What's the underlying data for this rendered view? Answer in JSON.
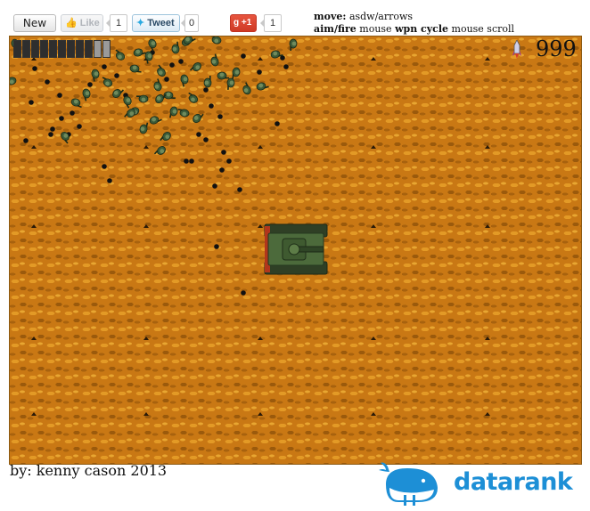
{
  "toolbar": {
    "new_label": "New",
    "like_label": "Like",
    "like_count": "1",
    "tweet_label": "Tweet",
    "tweet_count": "0",
    "plus_label": "+1",
    "plus_count": "1"
  },
  "controls": {
    "move_key": "move:",
    "move_val": "asdw/arrows",
    "aim_key": "aim/fire",
    "aim_val": "mouse",
    "wpn_key": "wpn cycle",
    "wpn_val": "mouse scroll"
  },
  "hud": {
    "health_segments_filled": 9,
    "health_segments_total": 11,
    "ammo": "999",
    "ammo_icon": "rocket-icon"
  },
  "footer": {
    "credit": "by: kenny cason 2013",
    "brand_name": "datarank",
    "brand_icon": "whale-icon"
  },
  "colors": {
    "terrain": "#c97814",
    "tank": "#4c6a3b",
    "enemies": "#3b5a38",
    "brand": "#1d8fd6"
  }
}
